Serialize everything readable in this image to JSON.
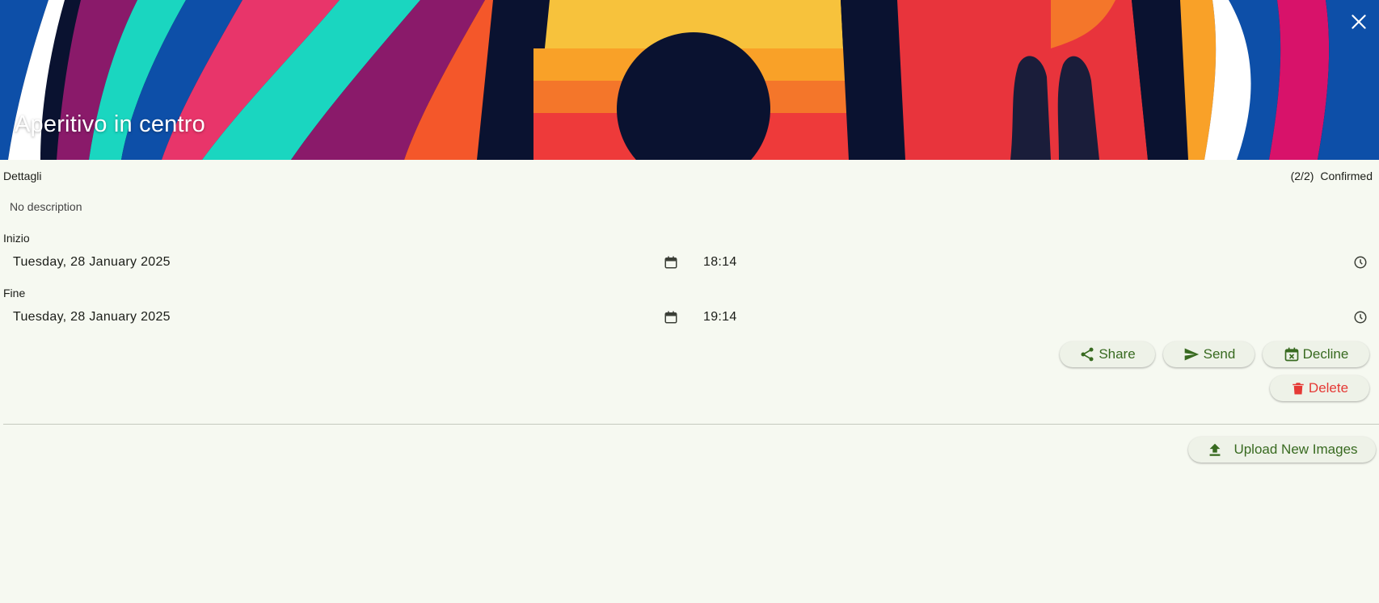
{
  "header": {
    "title": "Aperitivo in centro"
  },
  "details": {
    "section_label": "Dettagli",
    "status_count": "(2/2)",
    "status_label": "Confirmed",
    "description": "No description"
  },
  "start": {
    "label": "Inizio",
    "date": "Tuesday, 28 January 2025",
    "time": "18:14"
  },
  "end": {
    "label": "Fine",
    "date": "Tuesday, 28 January 2025",
    "time": "19:14"
  },
  "actions": {
    "share": "Share",
    "send": "Send",
    "decline": "Decline",
    "delete": "Delete",
    "upload": "Upload New Images"
  },
  "colors": {
    "background": "#f6f9f1",
    "accent": "#386a20",
    "danger": "#e53935"
  },
  "icons": [
    "close-icon",
    "calendar-icon",
    "clock-icon",
    "share-icon",
    "send-icon",
    "calendar-x-icon",
    "trash-icon",
    "upload-icon"
  ]
}
